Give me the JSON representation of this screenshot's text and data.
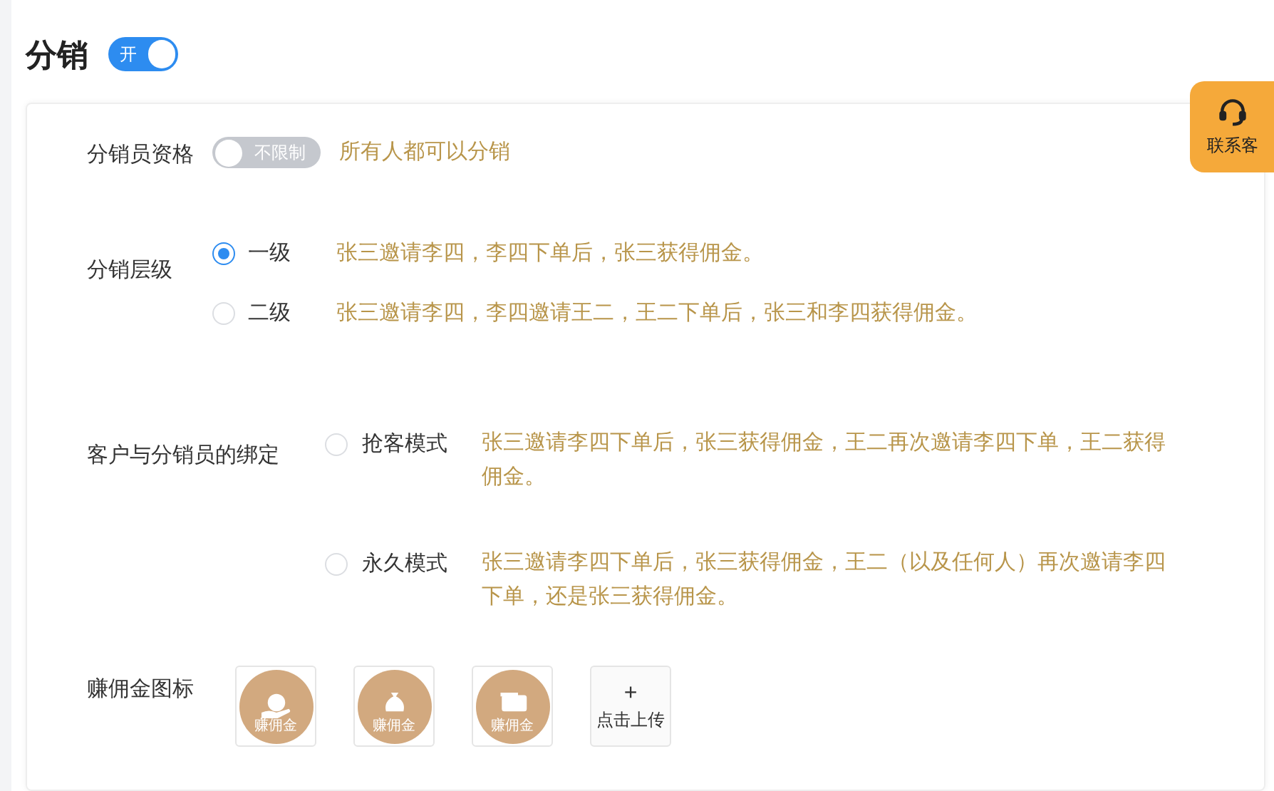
{
  "header": {
    "title": "分销",
    "toggle": {
      "on": true,
      "label": "开"
    }
  },
  "service_button": {
    "label": "联系客"
  },
  "qualification": {
    "label": "分销员资格",
    "toggle": {
      "on": false,
      "label": "不限制"
    },
    "description": "所有人都可以分销"
  },
  "levels": {
    "label": "分销层级",
    "options": [
      {
        "label": "一级",
        "selected": true,
        "description": "张三邀请李四，李四下单后，张三获得佣金。"
      },
      {
        "label": "二级",
        "selected": false,
        "description": "张三邀请李四，李四邀请王二，王二下单后，张三和李四获得佣金。"
      }
    ]
  },
  "binding": {
    "label": "客户与分销员的绑定",
    "options": [
      {
        "label": "抢客模式",
        "selected": false,
        "description": "张三邀请李四下单后，张三获得佣金，王二再次邀请李四下单，王二获得佣金。"
      },
      {
        "label": "永久模式",
        "selected": false,
        "description": "张三邀请李四下单后，张三获得佣金，王二（以及任何人）再次邀请李四下单，还是张三获得佣金。"
      }
    ]
  },
  "commission_icons": {
    "label": "赚佣金图标",
    "icons": [
      {
        "kind": "hand",
        "label": "赚佣金"
      },
      {
        "kind": "bag",
        "label": "赚佣金"
      },
      {
        "kind": "wallet",
        "label": "赚佣金"
      }
    ],
    "upload": {
      "symbol": "+",
      "label": "点击上传"
    }
  }
}
